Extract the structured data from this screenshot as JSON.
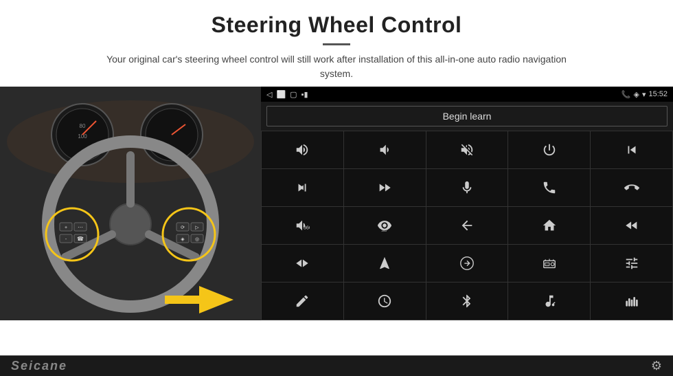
{
  "header": {
    "title": "Steering Wheel Control",
    "subtitle": "Your original car's steering wheel control will still work after installation of this all-in-one auto radio navigation system."
  },
  "status_bar": {
    "time": "15:52",
    "back_icon": "◁",
    "home_icon": "□",
    "recents_icon": "▢",
    "sim_icon": "▪▪",
    "phone_icon": "📞",
    "location_icon": "◈",
    "wifi_icon": "▾"
  },
  "begin_learn": {
    "label": "Begin learn"
  },
  "footer": {
    "brand": "Seicane"
  },
  "grid_buttons": [
    {
      "id": "vol-up",
      "icon": "vol-up"
    },
    {
      "id": "vol-down",
      "icon": "vol-down"
    },
    {
      "id": "mute",
      "icon": "mute"
    },
    {
      "id": "power",
      "icon": "power"
    },
    {
      "id": "prev-track",
      "icon": "prev-track"
    },
    {
      "id": "skip-next",
      "icon": "skip-next"
    },
    {
      "id": "fast-fwd",
      "icon": "fast-fwd"
    },
    {
      "id": "mic",
      "icon": "mic"
    },
    {
      "id": "phone",
      "icon": "phone"
    },
    {
      "id": "hang-up",
      "icon": "hang-up"
    },
    {
      "id": "horn",
      "icon": "horn"
    },
    {
      "id": "360-view",
      "icon": "360-view"
    },
    {
      "id": "back",
      "icon": "back"
    },
    {
      "id": "home",
      "icon": "home"
    },
    {
      "id": "rewind",
      "icon": "rewind"
    },
    {
      "id": "fast-skip",
      "icon": "fast-skip"
    },
    {
      "id": "nav",
      "icon": "nav"
    },
    {
      "id": "equalizer",
      "icon": "equalizer"
    },
    {
      "id": "radio",
      "icon": "radio"
    },
    {
      "id": "settings-tune",
      "icon": "settings-tune"
    },
    {
      "id": "pen",
      "icon": "pen"
    },
    {
      "id": "clock",
      "icon": "clock"
    },
    {
      "id": "bluetooth",
      "icon": "bluetooth"
    },
    {
      "id": "music",
      "icon": "music"
    },
    {
      "id": "spectrum",
      "icon": "spectrum"
    }
  ]
}
